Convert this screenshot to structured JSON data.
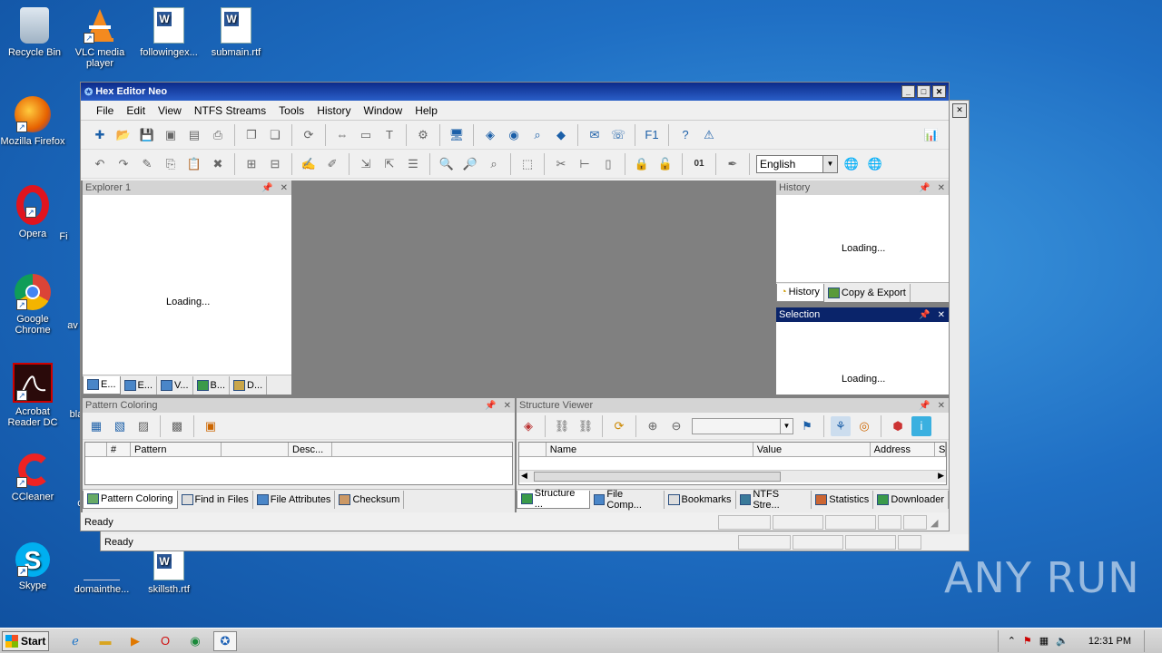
{
  "desktop": {
    "icons": [
      {
        "label": "Recycle Bin"
      },
      {
        "label": "VLC media player"
      },
      {
        "label": "followingex..."
      },
      {
        "label": "submain.rtf"
      },
      {
        "label": "Mozilla Firefox"
      },
      {
        "label": "Opera"
      },
      {
        "label": "Google Chrome"
      },
      {
        "label": "Acrobat Reader DC"
      },
      {
        "label": "CCleaner"
      },
      {
        "label": "Skype"
      },
      {
        "label": "domainthe..."
      },
      {
        "label": "skillsth.rtf"
      }
    ],
    "partial_labels": [
      "Fi",
      "av",
      "bla",
      "c"
    ]
  },
  "back_window": {
    "status": "Ready"
  },
  "app": {
    "title": "Hex Editor Neo",
    "menu": [
      "File",
      "Edit",
      "View",
      "NTFS Streams",
      "Tools",
      "History",
      "Window",
      "Help"
    ],
    "language": "English",
    "explorer": {
      "title": "Explorer 1",
      "loading": "Loading...",
      "tabs": [
        "E...",
        "E...",
        "V...",
        "B...",
        "D..."
      ]
    },
    "history": {
      "title": "History",
      "loading": "Loading...",
      "tabs": [
        "History",
        "Copy & Export"
      ]
    },
    "selection": {
      "title": "Selection",
      "loading": "Loading..."
    },
    "pattern": {
      "title": "Pattern Coloring",
      "columns": [
        "#",
        "Pattern",
        "",
        "Desc..."
      ],
      "tabs": [
        "Pattern Coloring",
        "Find in Files",
        "File Attributes",
        "Checksum"
      ]
    },
    "structure": {
      "title": "Structure Viewer",
      "columns": [
        "Name",
        "Value",
        "Address",
        "S"
      ],
      "tabs": [
        "Structure ...",
        "File Comp...",
        "Bookmarks",
        "NTFS Stre...",
        "Statistics",
        "Downloader"
      ]
    },
    "status": "Ready"
  },
  "taskbar": {
    "start": "Start",
    "clock": "12:31 PM"
  },
  "watermark": "ANY RUN"
}
